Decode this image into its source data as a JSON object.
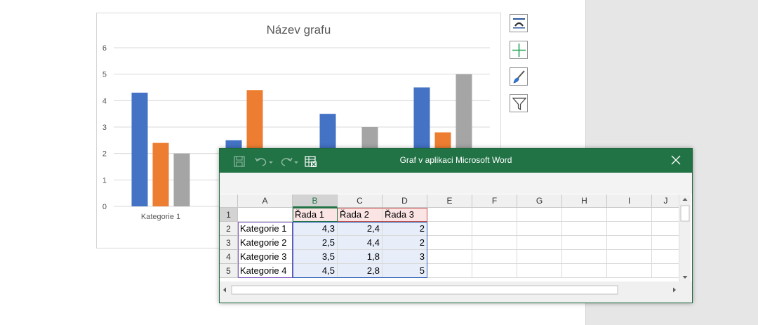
{
  "chart_data": {
    "type": "bar",
    "title": "Název grafu",
    "categories": [
      "Kategorie 1",
      "Kategorie 2",
      "Kategorie 3",
      "Kategorie 4"
    ],
    "series": [
      {
        "name": "Řada 1",
        "values": [
          4.3,
          2.5,
          3.5,
          4.5
        ],
        "color": "#4472c4"
      },
      {
        "name": "Řada 2",
        "values": [
          2.4,
          4.4,
          1.8,
          2.8
        ],
        "color": "#ed7d31"
      },
      {
        "name": "Řada 3",
        "values": [
          2,
          2,
          3,
          5
        ],
        "color": "#a5a5a5"
      }
    ],
    "ylim": [
      0,
      6
    ],
    "yticks": [
      "0",
      "1",
      "2",
      "3",
      "4",
      "5",
      "6"
    ],
    "grid": true,
    "visible_category_label": "Kategorie 1"
  },
  "side_buttons": [
    {
      "icon": "chart-elements-icon"
    },
    {
      "icon": "plus-icon"
    },
    {
      "icon": "brush-icon"
    },
    {
      "icon": "filter-icon"
    }
  ],
  "excel": {
    "title": "Graf v aplikaci Microsoft Word",
    "columns": [
      "A",
      "B",
      "C",
      "D",
      "E",
      "F",
      "G",
      "H",
      "I",
      "J"
    ],
    "rows": [
      "1",
      "2",
      "3",
      "4",
      "5"
    ],
    "header_row": [
      "",
      "Řada 1",
      "Řada 2",
      "Řada 3"
    ],
    "data_rows": [
      [
        "Kategorie 1",
        "4,3",
        "2,4",
        "2"
      ],
      [
        "Kategorie 2",
        "2,5",
        "4,4",
        "2"
      ],
      [
        "Kategorie 3",
        "3,5",
        "1,8",
        "3"
      ],
      [
        "Kategorie 4",
        "4,5",
        "2,8",
        "5"
      ]
    ],
    "accent": "#217346"
  }
}
